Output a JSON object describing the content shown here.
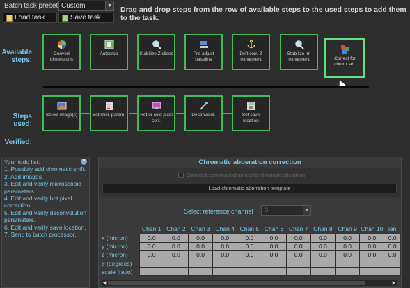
{
  "header": {
    "presets_label": "Batch task presets:",
    "preset_value": "Custom",
    "load_label": "Load task",
    "save_label": "Save task",
    "instruction": "Drag and drop steps from the row of available steps to the used steps to add them to the task."
  },
  "sections": {
    "available": "Available\nsteps:",
    "used": "Steps\nused:",
    "verified": "Verified:"
  },
  "available_steps": [
    {
      "label": "Convert dimensions",
      "icon": "colorwheel-icon"
    },
    {
      "label": "Autocrop",
      "icon": "crop-icon"
    },
    {
      "label": "Stabilize Z slices",
      "icon": "magnifier-icon"
    },
    {
      "label": "Pre-adjust baseline",
      "icon": "baseline-icon"
    },
    {
      "label": "Drift corr. Z movement",
      "icon": "anchor-icon"
    },
    {
      "label": "Stabilize irr. movement",
      "icon": "magnifier-icon"
    },
    {
      "label": "Correct for chrom. ab.",
      "icon": "chrom-icon"
    }
  ],
  "used_steps": [
    {
      "label": "Select image(s)",
      "icon": "image-icon"
    },
    {
      "label": "Set micr. param.",
      "icon": "clipboard-icon"
    },
    {
      "label": "Hot or cold pixel corr.",
      "icon": "monitor-icon"
    },
    {
      "label": "Deconvolut.",
      "icon": "wand-icon"
    },
    {
      "label": "Set save location",
      "icon": "save-icon"
    }
  ],
  "todo": {
    "text": "Your todo list:\n1. Possibly add chromatic shift.\n2. Add images.\n3. Edit and verify microscopic parameters.\n4. Edit and verify hot pixel correction.\n5. Edit and verify deconvolution parameters.\n6. Edit and verify save location.\n7. Send to batch processor.",
    "help": "?"
  },
  "chromatic": {
    "title": "Chromatic abberation correction",
    "checkbox_label": "Correct deconvolved channels for chromatic aberration",
    "load_button": "Load chromatic aberration template",
    "ref_label": "Select reference channel",
    "ref_value": "0",
    "columns": [
      "Chan 1",
      "Chan 2",
      "Chan 3",
      "Chan 4",
      "Chan 5",
      "Chan 6",
      "Chan 7",
      "Chan 8",
      "Chan 9",
      "Chan 10",
      "ian"
    ],
    "rows": [
      {
        "label": "x (micron)",
        "values": [
          "0.0",
          "0.0",
          "0.0",
          "0.0",
          "0.0",
          "0.0",
          "0.0",
          "0.0",
          "0.0",
          "0.0",
          "0.0"
        ]
      },
      {
        "label": "y (micron)",
        "values": [
          "0.0",
          "0.0",
          "0.0",
          "0.0",
          "0.0",
          "0.0",
          "0.0",
          "0.0",
          "0.0",
          "0.0",
          "0.0"
        ]
      },
      {
        "label": "z (micron)",
        "values": [
          "0.0",
          "0.0",
          "0.0",
          "0.0",
          "0.0",
          "0.0",
          "0.0",
          "0.0",
          "0.0",
          "0.0",
          "0.0"
        ]
      },
      {
        "label": "θ (degrees)",
        "values": [
          "",
          "",
          "",
          "",
          "",
          "",
          "",
          "",
          "",
          "",
          ""
        ]
      },
      {
        "label": "scale (ratio)",
        "values": [
          "",
          "",
          "",
          "",
          "",
          "",
          "",
          "",
          "",
          "",
          ""
        ]
      }
    ]
  },
  "colors": {
    "background": "#2d2d2d",
    "step_border": "#3fbb5a",
    "label_blue": "#79c8e8",
    "cell_grey": "#a9a9a9"
  }
}
